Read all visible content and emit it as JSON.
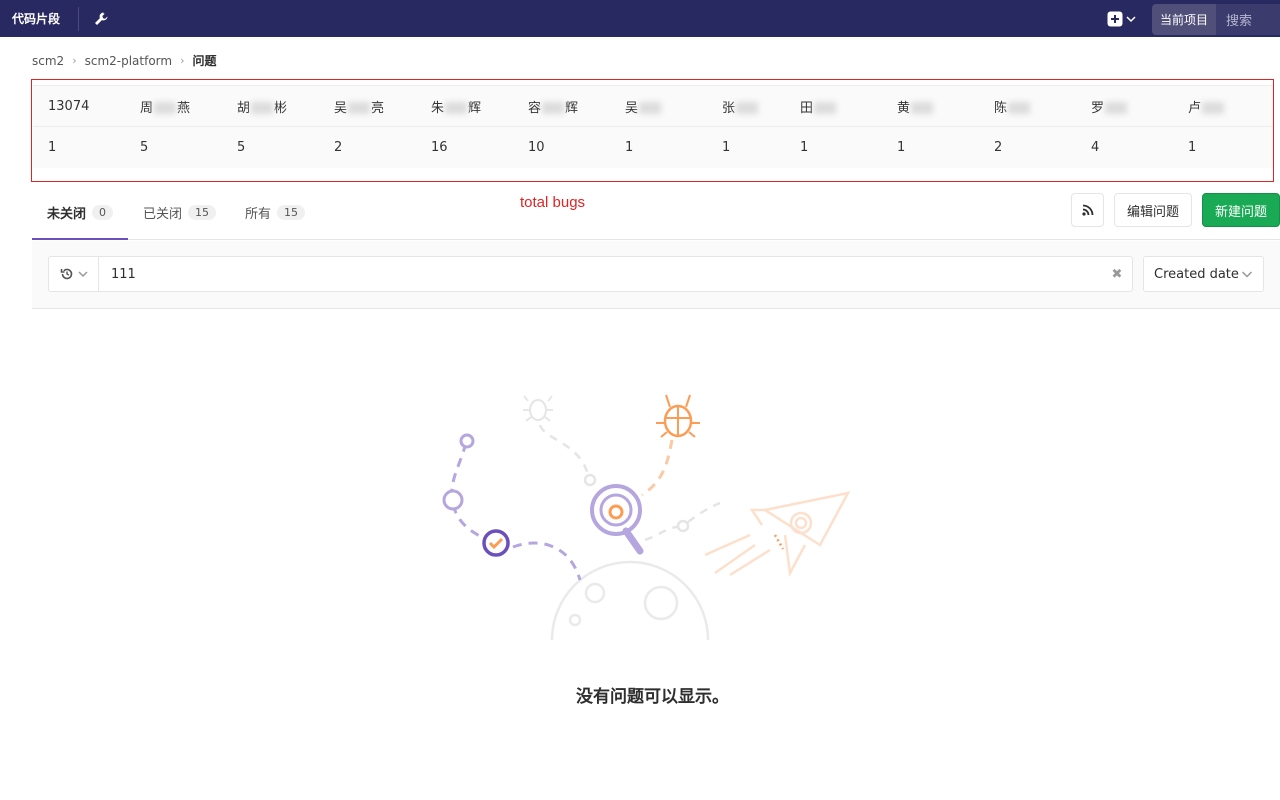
{
  "navbar": {
    "snippets_label": "代码片段",
    "scope_label": "当前项目",
    "search_placeholder": "搜索"
  },
  "breadcrumb": {
    "items": [
      "scm2",
      "scm2-platform"
    ],
    "current": "问题"
  },
  "stats": {
    "headers": [
      "13074",
      "周",
      "胡",
      "吴",
      "朱",
      "容",
      "吴",
      "张",
      "田",
      "黄",
      "陈",
      "罗",
      "卢"
    ],
    "header_suffix": [
      "",
      "燕",
      "彬",
      "亮",
      "辉",
      "辉",
      "",
      "",
      "",
      "",
      "",
      "",
      ""
    ],
    "values": [
      "1",
      "5",
      "5",
      "2",
      "16",
      "10",
      "1",
      "1",
      "1",
      "1",
      "2",
      "4",
      "1"
    ]
  },
  "annotation": "total bugs",
  "tabs": [
    {
      "label": "未关闭",
      "count": "0"
    },
    {
      "label": "已关闭",
      "count": "15"
    },
    {
      "label": "所有",
      "count": "15"
    }
  ],
  "actions": {
    "edit_label": "编辑问题",
    "new_label": "新建问题"
  },
  "filter": {
    "value": "111",
    "sort_label": "Created date"
  },
  "empty_state": {
    "message": "没有问题可以显示。"
  },
  "colors": {
    "navbar": "#292961",
    "accent": "#6b4fbb",
    "new_button": "#1aaa55",
    "annotation": "#e02424"
  }
}
